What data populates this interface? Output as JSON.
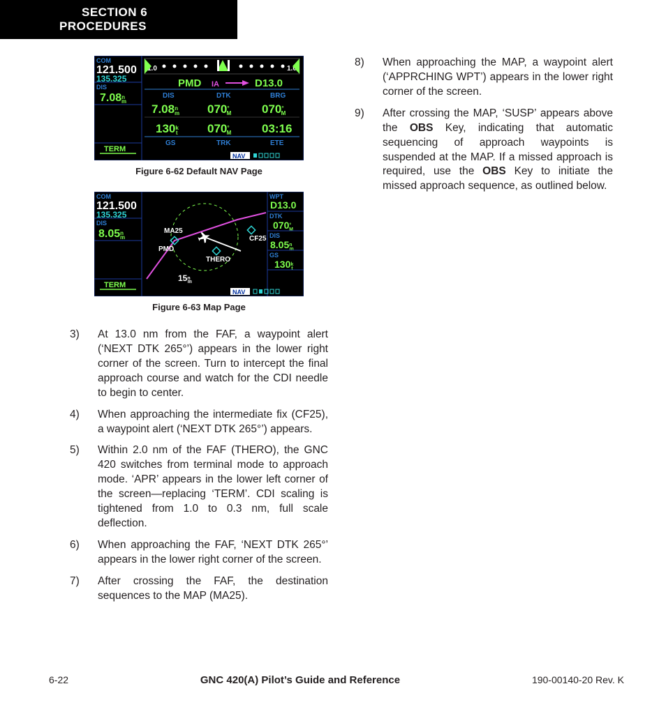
{
  "header": {
    "section": "SECTION 6",
    "title": "PROCEDURES"
  },
  "fig62": {
    "caption": "Figure 6-62  Default NAV Page",
    "com": "COM",
    "com_active": "121.500",
    "com_standby": "135.325",
    "dis_label": "DIS",
    "dis_val": "7.08",
    "term": "TERM",
    "cdi_left": "1.0",
    "cdi_right": "1.0",
    "from": "PMD",
    "ia": "IA",
    "to": "D13.0",
    "r1c1l": "DIS",
    "r1c2l": "DTK",
    "r1c3l": "BRG",
    "r1c1": "7.08",
    "r1c2": "070",
    "r1c3": "070",
    "r2c1": "130",
    "r2c2": "070",
    "r2c3": "03:16",
    "r2c1l": "GS",
    "r2c2l": "TRK",
    "r2c3l": "ETE",
    "nav": "NAV"
  },
  "fig63": {
    "caption": "Figure 6-63  Map Page",
    "com": "COM",
    "com_active": "121.500",
    "com_standby": "135.325",
    "dis_label": "DIS",
    "dis_val": "8.05",
    "term": "TERM",
    "wpt_l": "WPT",
    "wpt": "D13.0",
    "dtk_l": "DTK",
    "dtk": "070",
    "dis2_l": "DIS",
    "dis2": "8.05",
    "gs_l": "GS",
    "gs": "130",
    "scale": "15",
    "ma25": "MA25",
    "pmd": "PMD",
    "thero": "THERO",
    "cf25": "CF25",
    "nav": "NAV"
  },
  "steps_left": [
    {
      "n": "3)",
      "t": "At 13.0 nm from the FAF, a waypoint alert (‘NEXT DTK 265°’) appears in the lower right corner of the screen.  Turn to intercept the final approach course and watch for the CDI needle to begin to center."
    },
    {
      "n": "4)",
      "t": "When approaching the intermediate fix (CF25), a waypoint alert (‘NEXT DTK 265°’) appears."
    },
    {
      "n": "5)",
      "t": "Within 2.0 nm of the FAF (THERO), the GNC 420 switches from terminal mode to approach mode.  ‘APR’ appears in the lower left corner of the screen—replacing ‘TERM’.  CDI scaling is tightened from 1.0 to 0.3 nm, full scale deflection."
    },
    {
      "n": "6)",
      "t": "When approaching the FAF, ‘NEXT DTK 265°’ appears in the lower right corner of the screen."
    },
    {
      "n": "7)",
      "t": "After crossing the FAF, the destination sequences to the MAP (MA25)."
    }
  ],
  "steps_right": [
    {
      "n": "8)",
      "t": "When approaching the MAP, a waypoint alert (‘APPRCHING WPT’) appears in the lower right corner of the screen."
    },
    {
      "n": "9)",
      "t_html": "After crossing the MAP, ‘SUSP’ appears above the <b>OBS</b> Key, indicating that automatic sequencing of approach waypoints is suspended at the MAP.  If a missed approach is required, use the <b>OBS</b> Key to initiate the missed approach sequence, as outlined below."
    }
  ],
  "footer": {
    "page": "6-22",
    "title": "GNC 420(A) Pilot’s Guide and Reference",
    "rev": "190-00140-20  Rev. K"
  }
}
